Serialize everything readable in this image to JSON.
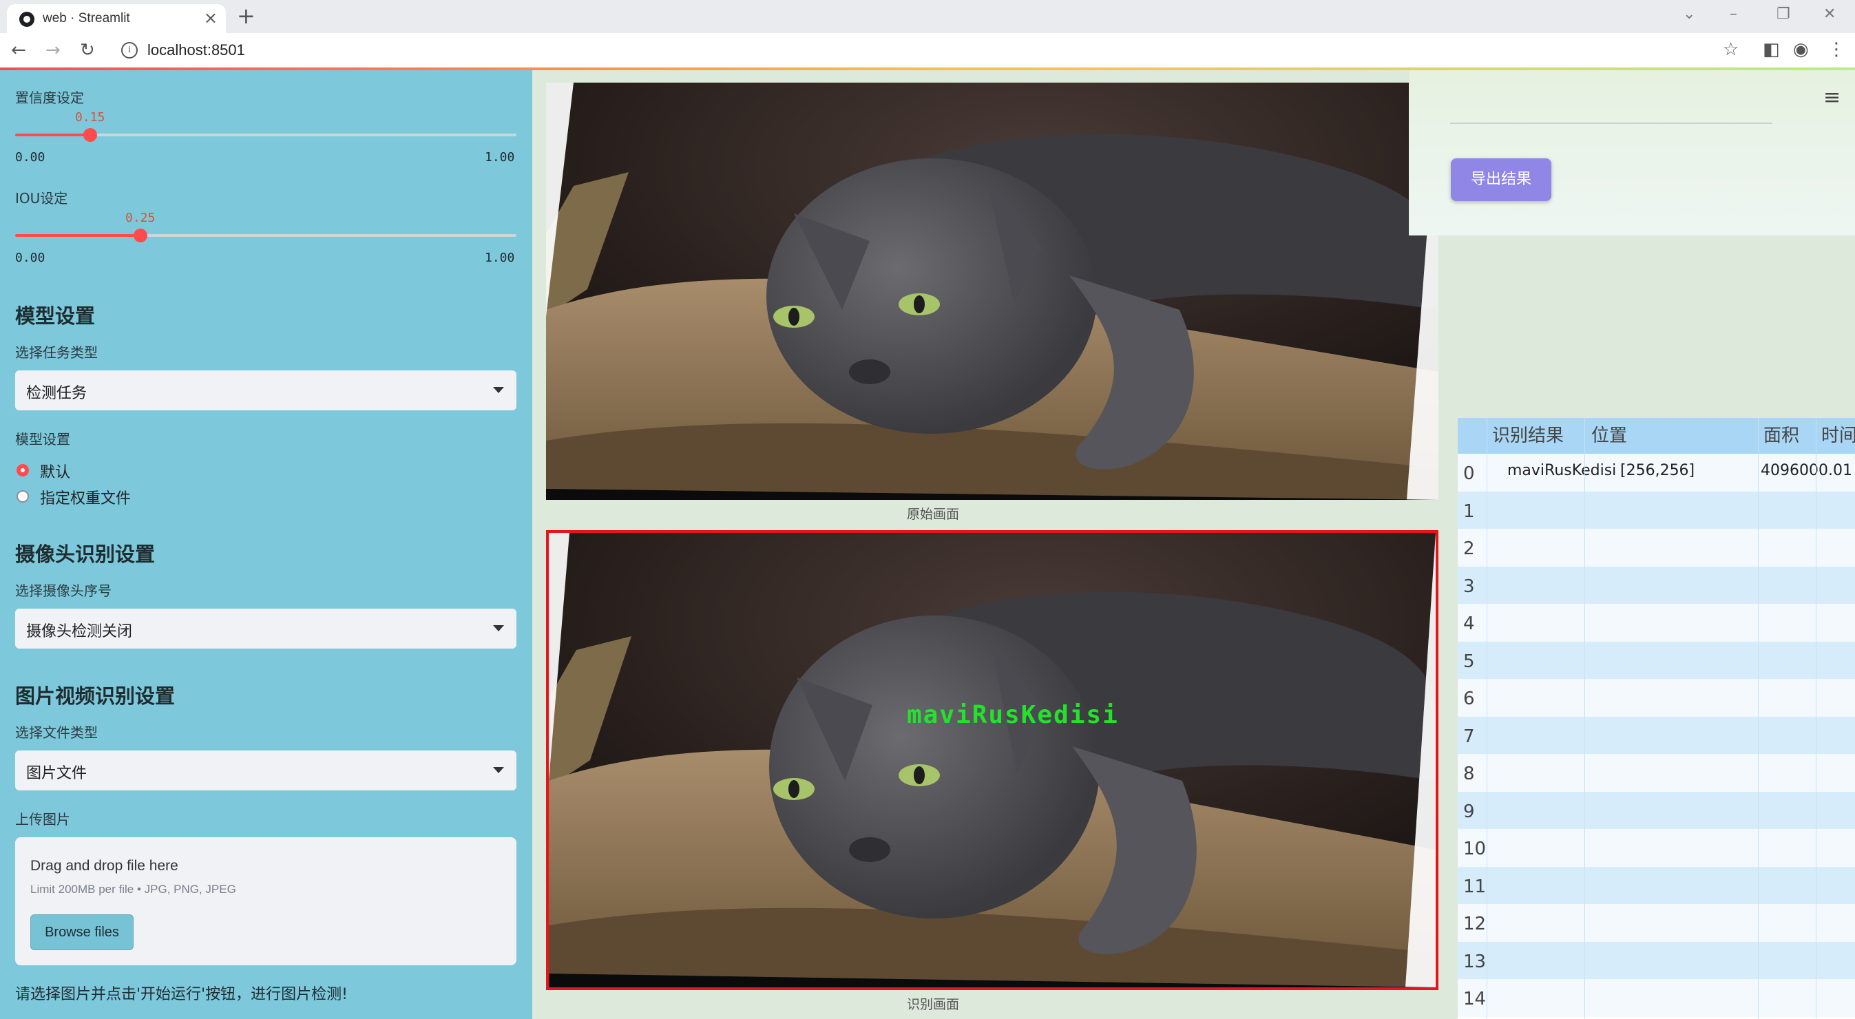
{
  "browser": {
    "tab_title": "web · Streamlit",
    "url": "localhost:8501"
  },
  "sidebar": {
    "confidence": {
      "label": "置信度设定",
      "value": "0.15",
      "value_num": 0.15,
      "min": "0.00",
      "max": "1.00"
    },
    "iou": {
      "label": "IOU设定",
      "value": "0.25",
      "value_num": 0.25,
      "min": "0.00",
      "max": "1.00"
    },
    "model_header": "模型设置",
    "task_label": "选择任务类型",
    "task_value": "检测任务",
    "model_label": "模型设置",
    "model_options": [
      "默认",
      "指定权重文件"
    ],
    "model_selected": 0,
    "camera_header": "摄像头识别设置",
    "camera_label": "选择摄像头序号",
    "camera_value": "摄像头检测关闭",
    "media_header": "图片视频识别设置",
    "filetype_label": "选择文件类型",
    "filetype_value": "图片文件",
    "upload_label": "上传图片",
    "upload": {
      "title": "Drag and drop file here",
      "limit": "Limit 200MB per file • JPG, PNG, JPEG",
      "browse": "Browse files"
    },
    "hint": "请选择图片并点击'开始运行'按钮，进行图片检测!"
  },
  "main": {
    "original_caption": "原始画面",
    "result_caption": "识别画面",
    "detection_label": "maviRusKedisi",
    "export_button": "导出结果",
    "table": {
      "columns": [
        "识别结果",
        "位置",
        "面积",
        "时间"
      ],
      "rows": [
        {
          "index": "0",
          "result": "maviRusKedisi",
          "position": "[256,256]",
          "area": "4096000.01",
          "time": ""
        },
        {
          "index": "1"
        },
        {
          "index": "2"
        },
        {
          "index": "3"
        },
        {
          "index": "4"
        },
        {
          "index": "5"
        },
        {
          "index": "6"
        },
        {
          "index": "7"
        },
        {
          "index": "8"
        },
        {
          "index": "9"
        },
        {
          "index": "10"
        },
        {
          "index": "11"
        },
        {
          "index": "12"
        },
        {
          "index": "13"
        },
        {
          "index": "14"
        }
      ]
    }
  },
  "colors": {
    "sidebar_bg": "#7ec8dc",
    "main_bg": "#dde9db",
    "accent": "#ff4b4b",
    "export_button": "#8f86e6",
    "detection_box": "#e8141c",
    "detection_text": "#22e22a"
  }
}
